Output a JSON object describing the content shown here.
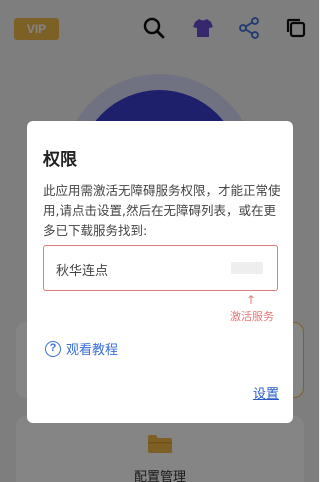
{
  "topbar": {
    "vip_label": "VIP",
    "icons": [
      "search-icon",
      "tshirt-icon",
      "share-icon",
      "copy-icon"
    ]
  },
  "main": {
    "bottom_card_label": "配置管理"
  },
  "dialog": {
    "title": "权限",
    "message": "此应用需激活无障碍服务权限，才能正常使用,请点击设置,然后在无障碍列表，或在更多已下载服务找到:",
    "service_name": "秋华连点",
    "arrow": "↑",
    "hint": "激活服务",
    "tutorial_label": "观看教程",
    "settings_label": "设置"
  },
  "colors": {
    "vip": "#f0b84a",
    "main_circle": "#3b3ed0",
    "accent_red": "#e57a7a",
    "link_blue": "#2a5bc7",
    "tshirt_purple": "#6a4bd1"
  }
}
